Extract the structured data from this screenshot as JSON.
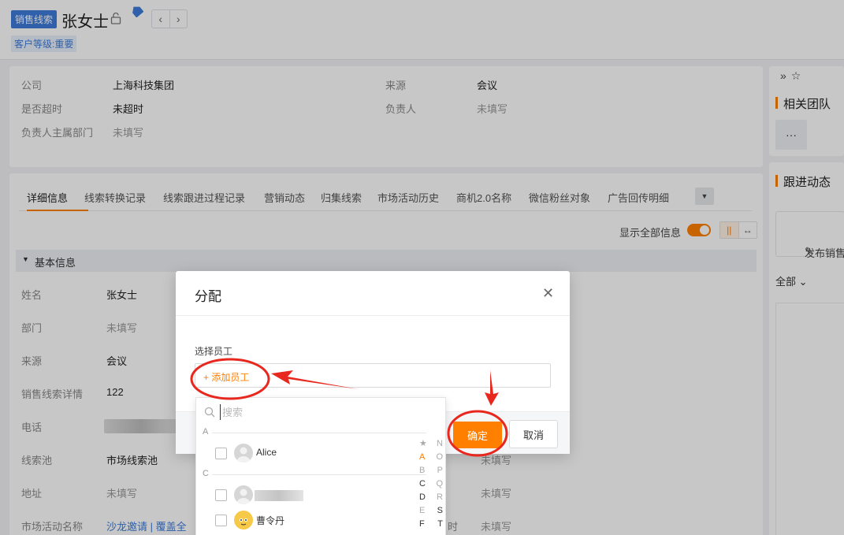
{
  "header": {
    "tag": "销售线索",
    "name": "张女士",
    "level": "客户等级:重要"
  },
  "summary": {
    "company_label": "公司",
    "company_value": "上海科技集团",
    "overdue_label": "是否超时",
    "overdue_value": "未超时",
    "dept_label": "负责人主属部门",
    "dept_value": "未填写",
    "source_label": "来源",
    "source_value": "会议",
    "owner_label": "负责人",
    "owner_value": "未填写"
  },
  "tabs": [
    "详细信息",
    "线索转换记录",
    "线索跟进过程记录",
    "营销动态",
    "归集线索",
    "市场活动历史",
    "商机2.0名称",
    "微信粉丝对象",
    "广告回传明细"
  ],
  "toolbar": {
    "show_all": "显示全部信息",
    "layout_a": "||",
    "layout_b": "↔"
  },
  "section": {
    "title": "基本信息"
  },
  "fields": [
    {
      "label": "姓名",
      "value": "张女士"
    },
    {
      "label": "部门",
      "value": "未填写"
    },
    {
      "label": "来源",
      "value": "会议"
    },
    {
      "label": "销售线索详情",
      "value": "122"
    },
    {
      "label": "电话",
      "value": ""
    },
    {
      "label": "线索池",
      "value": "市场线索池"
    },
    {
      "label": "地址",
      "value": "未填写"
    },
    {
      "label": "市场活动名称",
      "value": "沙龙邀请 | 覆盖全"
    }
  ],
  "right_fields": [
    {
      "value": "未填写"
    },
    {
      "value": "未填写"
    },
    {
      "label": "时",
      "value": "未填写"
    }
  ],
  "right_panel": {
    "team_title": "相关团队",
    "more": "···",
    "follow_title": "跟进动态",
    "publish": "发布销售",
    "filter": "全部"
  },
  "dialog": {
    "title": "分配",
    "select_label": "选择员工",
    "add_employee": "+ 添加员工",
    "confirm": "确定",
    "cancel": "取消"
  },
  "dropdown": {
    "search_placeholder": "搜索",
    "groups": [
      {
        "letter": "A",
        "employees": [
          "Alice"
        ]
      },
      {
        "letter": "C",
        "employees": [
          "",
          "曹令丹"
        ]
      }
    ],
    "index": [
      [
        "★",
        "N"
      ],
      [
        "A",
        "O"
      ],
      [
        "B",
        "P"
      ],
      [
        "C",
        "Q"
      ],
      [
        "D",
        "R"
      ],
      [
        "E",
        "S"
      ],
      [
        "F",
        "T"
      ]
    ]
  },
  "colors": {
    "accent": "#ff7f00",
    "brand_blue": "#3d7bd9",
    "annotation_red": "#e8281e"
  }
}
